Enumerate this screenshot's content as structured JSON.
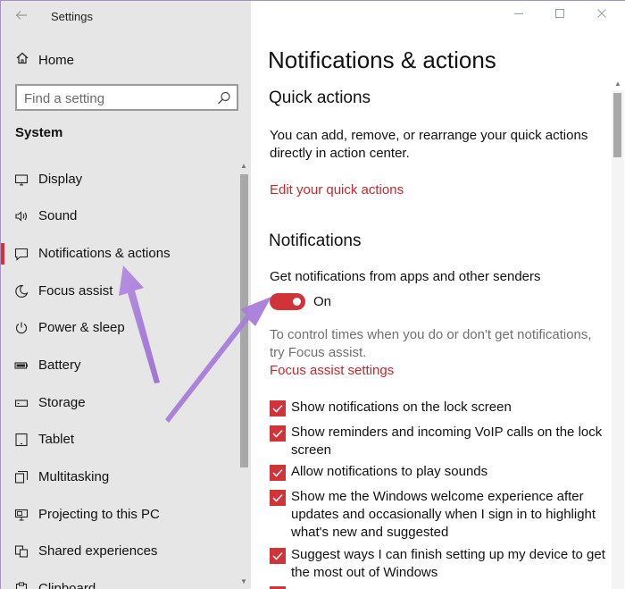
{
  "window": {
    "title": "Settings"
  },
  "sidebar": {
    "home_label": "Home",
    "search_placeholder": "Find a setting",
    "section_title": "System",
    "items": [
      {
        "label": "Display",
        "icon": "monitor-icon"
      },
      {
        "label": "Sound",
        "icon": "speaker-icon"
      },
      {
        "label": "Notifications & actions",
        "icon": "notification-icon",
        "selected": true
      },
      {
        "label": "Focus assist",
        "icon": "moon-icon"
      },
      {
        "label": "Power & sleep",
        "icon": "power-icon"
      },
      {
        "label": "Battery",
        "icon": "battery-icon"
      },
      {
        "label": "Storage",
        "icon": "storage-icon"
      },
      {
        "label": "Tablet",
        "icon": "tablet-icon"
      },
      {
        "label": "Multitasking",
        "icon": "multitasking-icon"
      },
      {
        "label": "Projecting to this PC",
        "icon": "projecting-icon"
      },
      {
        "label": "Shared experiences",
        "icon": "shared-icon"
      },
      {
        "label": "Clipboard",
        "icon": "clipboard-icon"
      }
    ]
  },
  "main": {
    "title": "Notifications & actions",
    "quick_actions": {
      "heading": "Quick actions",
      "description": "You can add, remove, or rearrange your quick actions directly in action center.",
      "link": "Edit your quick actions"
    },
    "notifications": {
      "heading": "Notifications",
      "toggle_caption": "Get notifications from apps and other senders",
      "toggle_state": "On",
      "focus_text": "To control times when you do or don't get notifications, try Focus assist.",
      "focus_link": "Focus assist settings",
      "checkboxes": [
        {
          "label": "Show notifications on the lock screen",
          "checked": true
        },
        {
          "label": "Show reminders and incoming VoIP calls on the lock screen",
          "checked": true
        },
        {
          "label": "Allow notifications to play sounds",
          "checked": true
        },
        {
          "label": "Show me the Windows welcome experience after updates and occasionally when I sign in to highlight what's new and suggested",
          "checked": true
        },
        {
          "label": "Suggest ways I can finish setting up my device to get the most out of Windows",
          "checked": true
        }
      ]
    }
  },
  "colors": {
    "accent": "#d13438",
    "link": "#c5282f",
    "sidebar_bg": "#e6e6e6",
    "annotation_arrow": "#a77ed6"
  }
}
